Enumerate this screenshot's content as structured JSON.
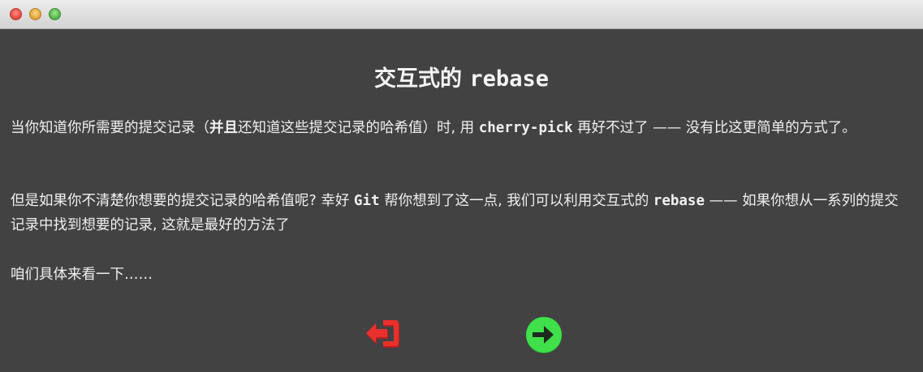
{
  "window": {
    "controls": [
      "close",
      "minimize",
      "maximize"
    ]
  },
  "dialog": {
    "title_prefix": "交互式的 ",
    "title_code": "rebase",
    "p1": {
      "a": "当你知道你所需要的提交记录（",
      "b": "并且",
      "c": "还知道这些提交记录的哈希值）时, 用 ",
      "d": "cherry-pick",
      "e": " 再好不过了 —— 没有比这更简单的方式了。"
    },
    "p2": {
      "a": "但是如果你不清楚你想要的提交记录的哈希值呢? 幸好 ",
      "b": "Git",
      "c": " 帮你想到了这一点, 我们可以利用交互式的 ",
      "d": "rebase",
      "e": " —— 如果你想从一系列的提交记录中找到想要的记录, 这就是最好的方法了"
    },
    "p3": "咱们具体来看一下……"
  },
  "buttons": {
    "back_icon": "exit-arrow-icon",
    "next_icon": "arrow-right-circle-icon",
    "back_color": "#e8302d",
    "next_color": "#3fe04a"
  }
}
